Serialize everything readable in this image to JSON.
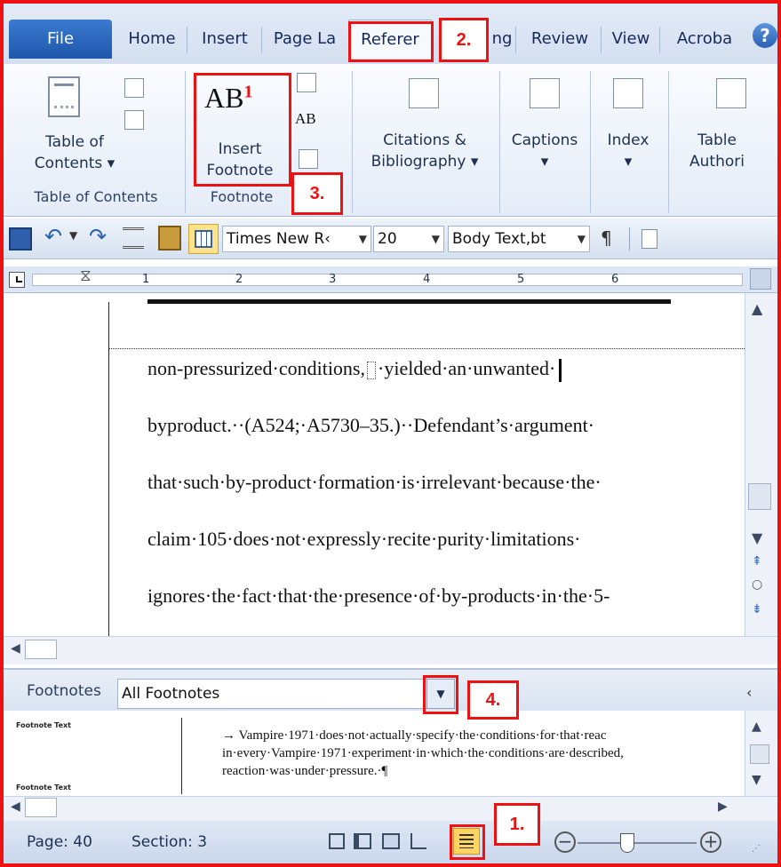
{
  "ribbon_tabs": {
    "file": "File",
    "home": "Home",
    "insert": "Insert",
    "page_layout": "Page La",
    "references": "Referer",
    "mailings": "ng",
    "review": "Review",
    "view": "View",
    "acrobat": "Acroba",
    "help": "?"
  },
  "ribbon": {
    "toc_button": [
      "Table of",
      "Contents ▾"
    ],
    "toc_group": "Table of Contents",
    "insert_footnote_icon": "AB",
    "insert_footnote_sup": "1",
    "insert_footnote": [
      "Insert",
      "Footnote"
    ],
    "footnotes_group": "Footnote",
    "next_footnote_icon": "AB",
    "citations": [
      "Citations &",
      "Bibliography ▾"
    ],
    "captions": [
      "Captions",
      "▾"
    ],
    "index": [
      "Index",
      "▾"
    ],
    "table_auth": [
      "Table",
      "Authori"
    ]
  },
  "quick_access": {
    "font_name": "Times New R‹",
    "font_size": "20",
    "style": "Body Text,bt",
    "pilcrow": "¶"
  },
  "ruler": {
    "ticks": [
      "1",
      "2",
      "3",
      "4",
      "5",
      "6"
    ]
  },
  "document": {
    "lines": [
      "non-pressurized·conditions,",
      "·yielded·an·unwanted·",
      "byproduct.··(A524;·A5730–35.)··Defendant’s·argument·",
      "that·such·by-product·formation·is·irrelevant·because·the·",
      "claim·105·does·not·expressly·recite·purity·limitations·",
      "ignores·the·fact·that·the·presence·of·by-products·in·the·5-"
    ]
  },
  "footnotes_pane": {
    "label": "Footnotes",
    "dropdown_value": "All Footnotes",
    "style_label_1": "Footnote Text",
    "style_label_2": "Footnote Text",
    "text_lines": [
      "→  Vampire·1971·does·not·actually·specify·the·conditions·for·that·reac",
      "in·every·Vampire·1971·experiment·in·which·the·conditions·are·described,",
      "reaction·was·under·pressure.·¶"
    ]
  },
  "status_bar": {
    "page": "Page: 40",
    "section": "Section: 3"
  },
  "callouts": {
    "one": "1.",
    "two": "2.",
    "three": "3.",
    "four": "4."
  },
  "colors": {
    "callout_red": "#ee1111",
    "file_tab_blue": "#2a63b8",
    "ribbon_bg": "#e4ecf7"
  }
}
